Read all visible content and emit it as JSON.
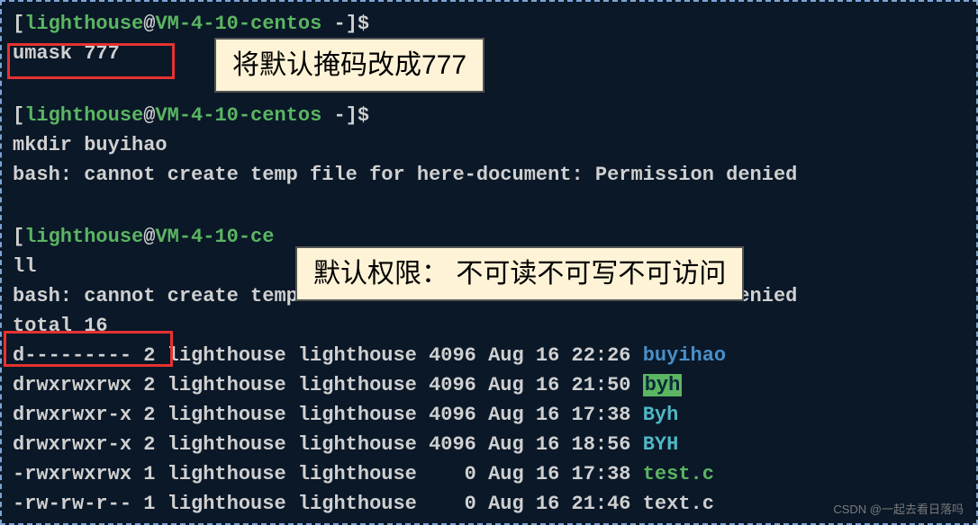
{
  "prompts": {
    "p1": {
      "user": "lighthouse",
      "host": "VM-4-10-centos",
      "path": "-",
      "symbol": "$"
    },
    "p2": {
      "user": "lighthouse",
      "host": "VM-4-10-centos",
      "path": "-",
      "symbol": "$"
    },
    "p3": {
      "user": "lighthouse",
      "host": "VM-4-10-ce",
      "path": "",
      "symbol": ""
    }
  },
  "commands": {
    "umask": "umask 777",
    "mkdir": "mkdir buyihao",
    "ll": "ll"
  },
  "output": {
    "bash_error": "bash: cannot create temp file for here-document: Permission denied",
    "total": "total 16"
  },
  "listing": [
    {
      "perm": "d---------",
      "links": "2",
      "owner": "lighthouse",
      "group": "lighthouse",
      "size": "4096",
      "date": "Aug 16 22:26",
      "name": "buyihao",
      "cls": "dir-name-blue"
    },
    {
      "perm": "drwxrwxrwx",
      "links": "2",
      "owner": "lighthouse",
      "group": "lighthouse",
      "size": "4096",
      "date": "Aug 16 21:50",
      "name": "byh",
      "cls": "bg-green"
    },
    {
      "perm": "drwxrwxr-x",
      "links": "2",
      "owner": "lighthouse",
      "group": "lighthouse",
      "size": "4096",
      "date": "Aug 16 17:38",
      "name": "Byh",
      "cls": "dir-name-cyan"
    },
    {
      "perm": "drwxrwxr-x",
      "links": "2",
      "owner": "lighthouse",
      "group": "lighthouse",
      "size": "4096",
      "date": "Aug 16 18:56",
      "name": "BYH",
      "cls": "dir-name-cyan"
    },
    {
      "perm": "-rwxrwxrwx",
      "links": "1",
      "owner": "lighthouse",
      "group": "lighthouse",
      "size": "   0",
      "date": "Aug 16 17:38",
      "name": "test.c",
      "cls": "exec-green"
    },
    {
      "perm": "-rw-rw-r--",
      "links": "1",
      "owner": "lighthouse",
      "group": "lighthouse",
      "size": "   0",
      "date": "Aug 16 21:46",
      "name": "text.c",
      "cls": "text-white"
    }
  ],
  "annotations": {
    "a1": "将默认掩码改成777",
    "a2": "默认权限： 不可读不可写不可访问"
  },
  "watermark": "CSDN @一起去看日落吗"
}
